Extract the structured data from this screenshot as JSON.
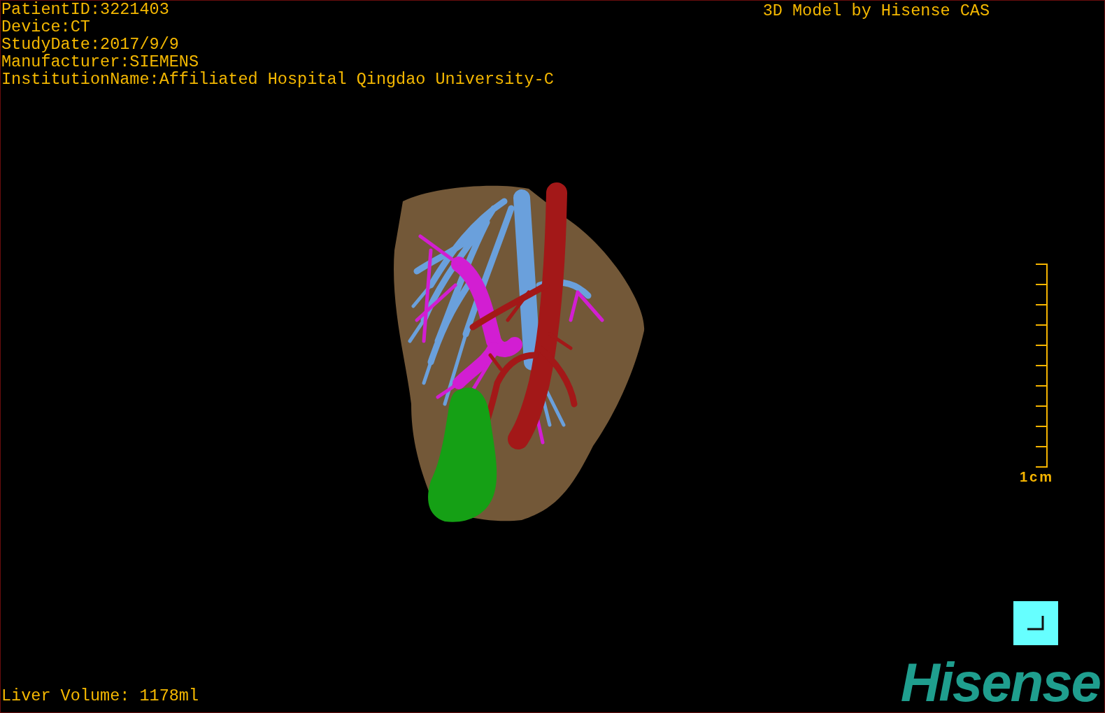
{
  "info_lines": [
    "PatientID:3221403",
    "Device:CT",
    "StudyDate:2017/9/9",
    "Manufacturer:SIEMENS",
    "InstitutionName:Affiliated Hospital Qingdao University-C"
  ],
  "model_title": "3D Model by Hisense CAS",
  "scale_bar": {
    "label": "1cm"
  },
  "liver_volume": "Liver Volume: 1178ml",
  "logo": "Hisense"
}
